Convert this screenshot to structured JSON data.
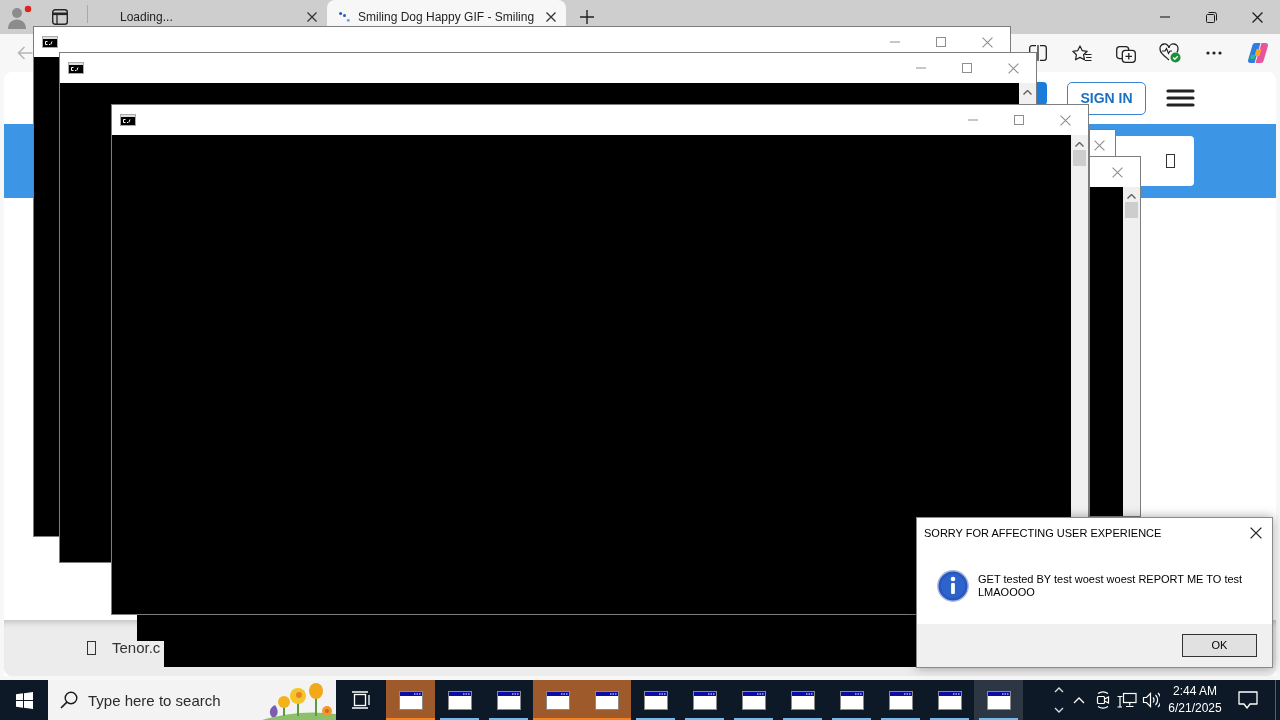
{
  "browser": {
    "tabs": [
      {
        "label": "Loading...",
        "selected": false
      },
      {
        "label": "Smiling Dog Happy GIF - Smiling",
        "selected": true
      }
    ],
    "page": {
      "sign_in_button": "SIGN IN",
      "footer_text": "Tenor.c"
    }
  },
  "dialog": {
    "title": "SORRY FOR AFFECTING USER EXPERIENCE",
    "message": "GET tested BY test woest woest REPORT ME TO test LMAOOOO",
    "buttons": [
      "OK"
    ]
  },
  "taskbar": {
    "search": {
      "placeholder": "Type here to search"
    },
    "apps": [
      {
        "flashing": true,
        "selected": false
      },
      {
        "flashing": false,
        "selected": false
      },
      {
        "flashing": false,
        "selected": false
      },
      {
        "flashing": true,
        "selected": false
      },
      {
        "flashing": true,
        "selected": false
      },
      {
        "flashing": false,
        "selected": false
      },
      {
        "flashing": false,
        "selected": false
      },
      {
        "flashing": false,
        "selected": false
      },
      {
        "flashing": false,
        "selected": false
      },
      {
        "flashing": false,
        "selected": false
      },
      {
        "flashing": false,
        "selected": false
      },
      {
        "flashing": false,
        "selected": false
      },
      {
        "flashing": false,
        "selected": true
      }
    ],
    "clock": {
      "time": "2:44 AM",
      "date": "6/21/2025"
    }
  }
}
